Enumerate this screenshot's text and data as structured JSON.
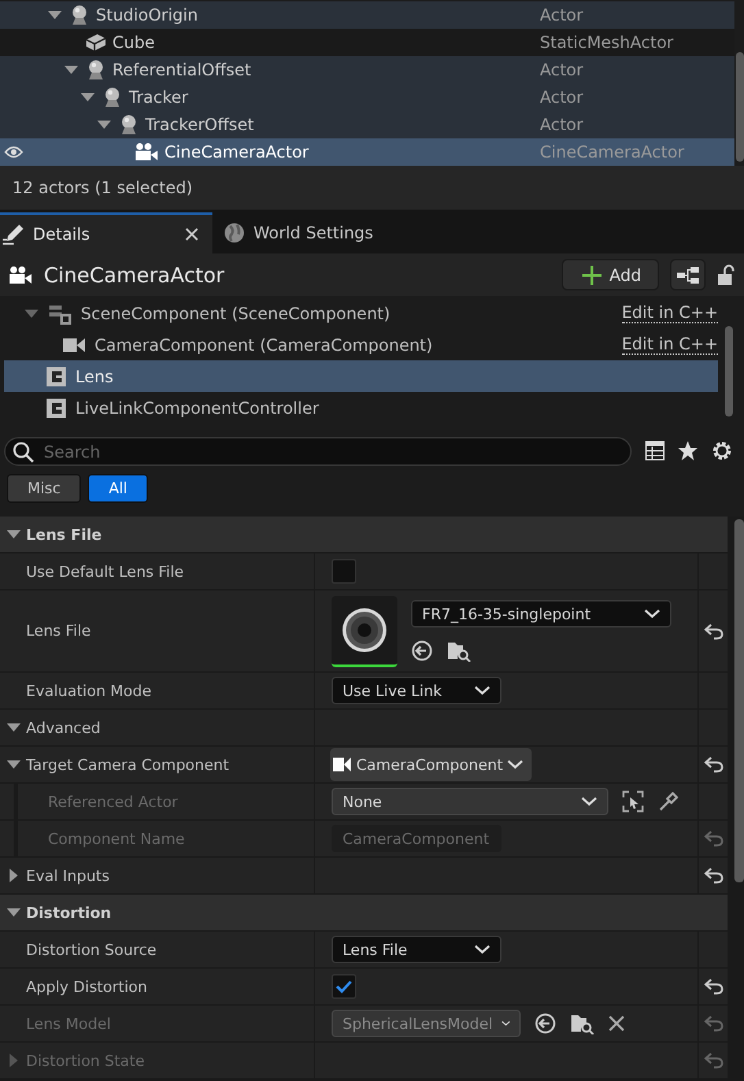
{
  "outliner": {
    "rows": [
      {
        "label": "StudioOrigin",
        "type": "Actor",
        "kind": "actor",
        "expanded": true,
        "selected": false,
        "children": [
          {
            "label": "Cube",
            "type": "StaticMeshActor",
            "kind": "mesh",
            "selected": false
          },
          {
            "label": "ReferentialOffset",
            "type": "Actor",
            "kind": "actor",
            "expanded": true,
            "selected": false,
            "children": [
              {
                "label": "Tracker",
                "type": "Actor",
                "kind": "actor",
                "expanded": true,
                "selected": false,
                "children": [
                  {
                    "label": "TrackerOffset",
                    "type": "Actor",
                    "kind": "actor",
                    "expanded": true,
                    "selected": false,
                    "children": [
                      {
                        "label": "CineCameraActor",
                        "type": "CineCameraActor",
                        "kind": "camera",
                        "selected": true
                      }
                    ]
                  }
                ]
              }
            ]
          }
        ]
      }
    ],
    "status": "12 actors (1 selected)"
  },
  "tabs": [
    {
      "label": "Details",
      "kind": "details",
      "selected": true
    },
    {
      "label": "World Settings",
      "kind": "world",
      "selected": false
    }
  ],
  "header": {
    "title": "CineCameraActor",
    "add_button": "Add"
  },
  "components": [
    {
      "label": "SceneComponent (SceneComponent)",
      "kind": "scene",
      "link": "Edit in C++",
      "expanded": true,
      "selected": false,
      "children": [
        {
          "label": "CameraComponent (CameraComponent)",
          "kind": "camera",
          "link": "Edit in C++",
          "selected": false
        }
      ]
    },
    {
      "label": "Lens",
      "kind": "class",
      "selected": true
    },
    {
      "label": "LiveLinkComponentController",
      "kind": "class",
      "selected": false
    }
  ],
  "search": {
    "placeholder": "Search"
  },
  "filters": [
    {
      "label": "Misc",
      "selected": false
    },
    {
      "label": "All",
      "selected": true
    }
  ],
  "properties": [
    {
      "kind": "section",
      "label": "Lens File",
      "expanded": true,
      "children": [
        {
          "kind": "checkbox",
          "label": "Use Default Lens File",
          "checked": false,
          "reset": false,
          "disabled": false
        },
        {
          "kind": "asset",
          "label": "Lens File",
          "value": "FR7_16-35-singlepoint",
          "reset": true,
          "disabled": false
        },
        {
          "kind": "combo",
          "label": "Evaluation Mode",
          "value": "Use Live Link",
          "reset": false,
          "disabled": false
        },
        {
          "kind": "group",
          "label": "Advanced",
          "expanded": true,
          "children": [
            {
              "kind": "component",
              "label": "Target Camera Component",
              "value": "CameraComponent",
              "expanded": true,
              "reset": true,
              "disabled": false,
              "children": [
                {
                  "kind": "actor",
                  "label": "Referenced Actor",
                  "value": "None",
                  "reset": false,
                  "disabled": true
                },
                {
                  "kind": "text",
                  "label": "Component Name",
                  "value": "CameraComponent",
                  "reset": true,
                  "disabled": true
                }
              ]
            },
            {
              "kind": "struct",
              "label": "Eval Inputs",
              "expanded": false,
              "reset": true,
              "disabled": false
            }
          ]
        }
      ]
    },
    {
      "kind": "section",
      "label": "Distortion",
      "expanded": true,
      "children": [
        {
          "kind": "combo",
          "label": "Distortion Source",
          "value": "Lens File",
          "reset": false,
          "disabled": false
        },
        {
          "kind": "checkbox",
          "label": "Apply Distortion",
          "checked": true,
          "reset": true,
          "disabled": false
        },
        {
          "kind": "class",
          "label": "Lens Model",
          "value": "SphericalLensModel",
          "reset": true,
          "disabled": true
        },
        {
          "kind": "struct",
          "label": "Distortion State",
          "expanded": false,
          "reset": true,
          "disabled": true
        }
      ]
    }
  ]
}
